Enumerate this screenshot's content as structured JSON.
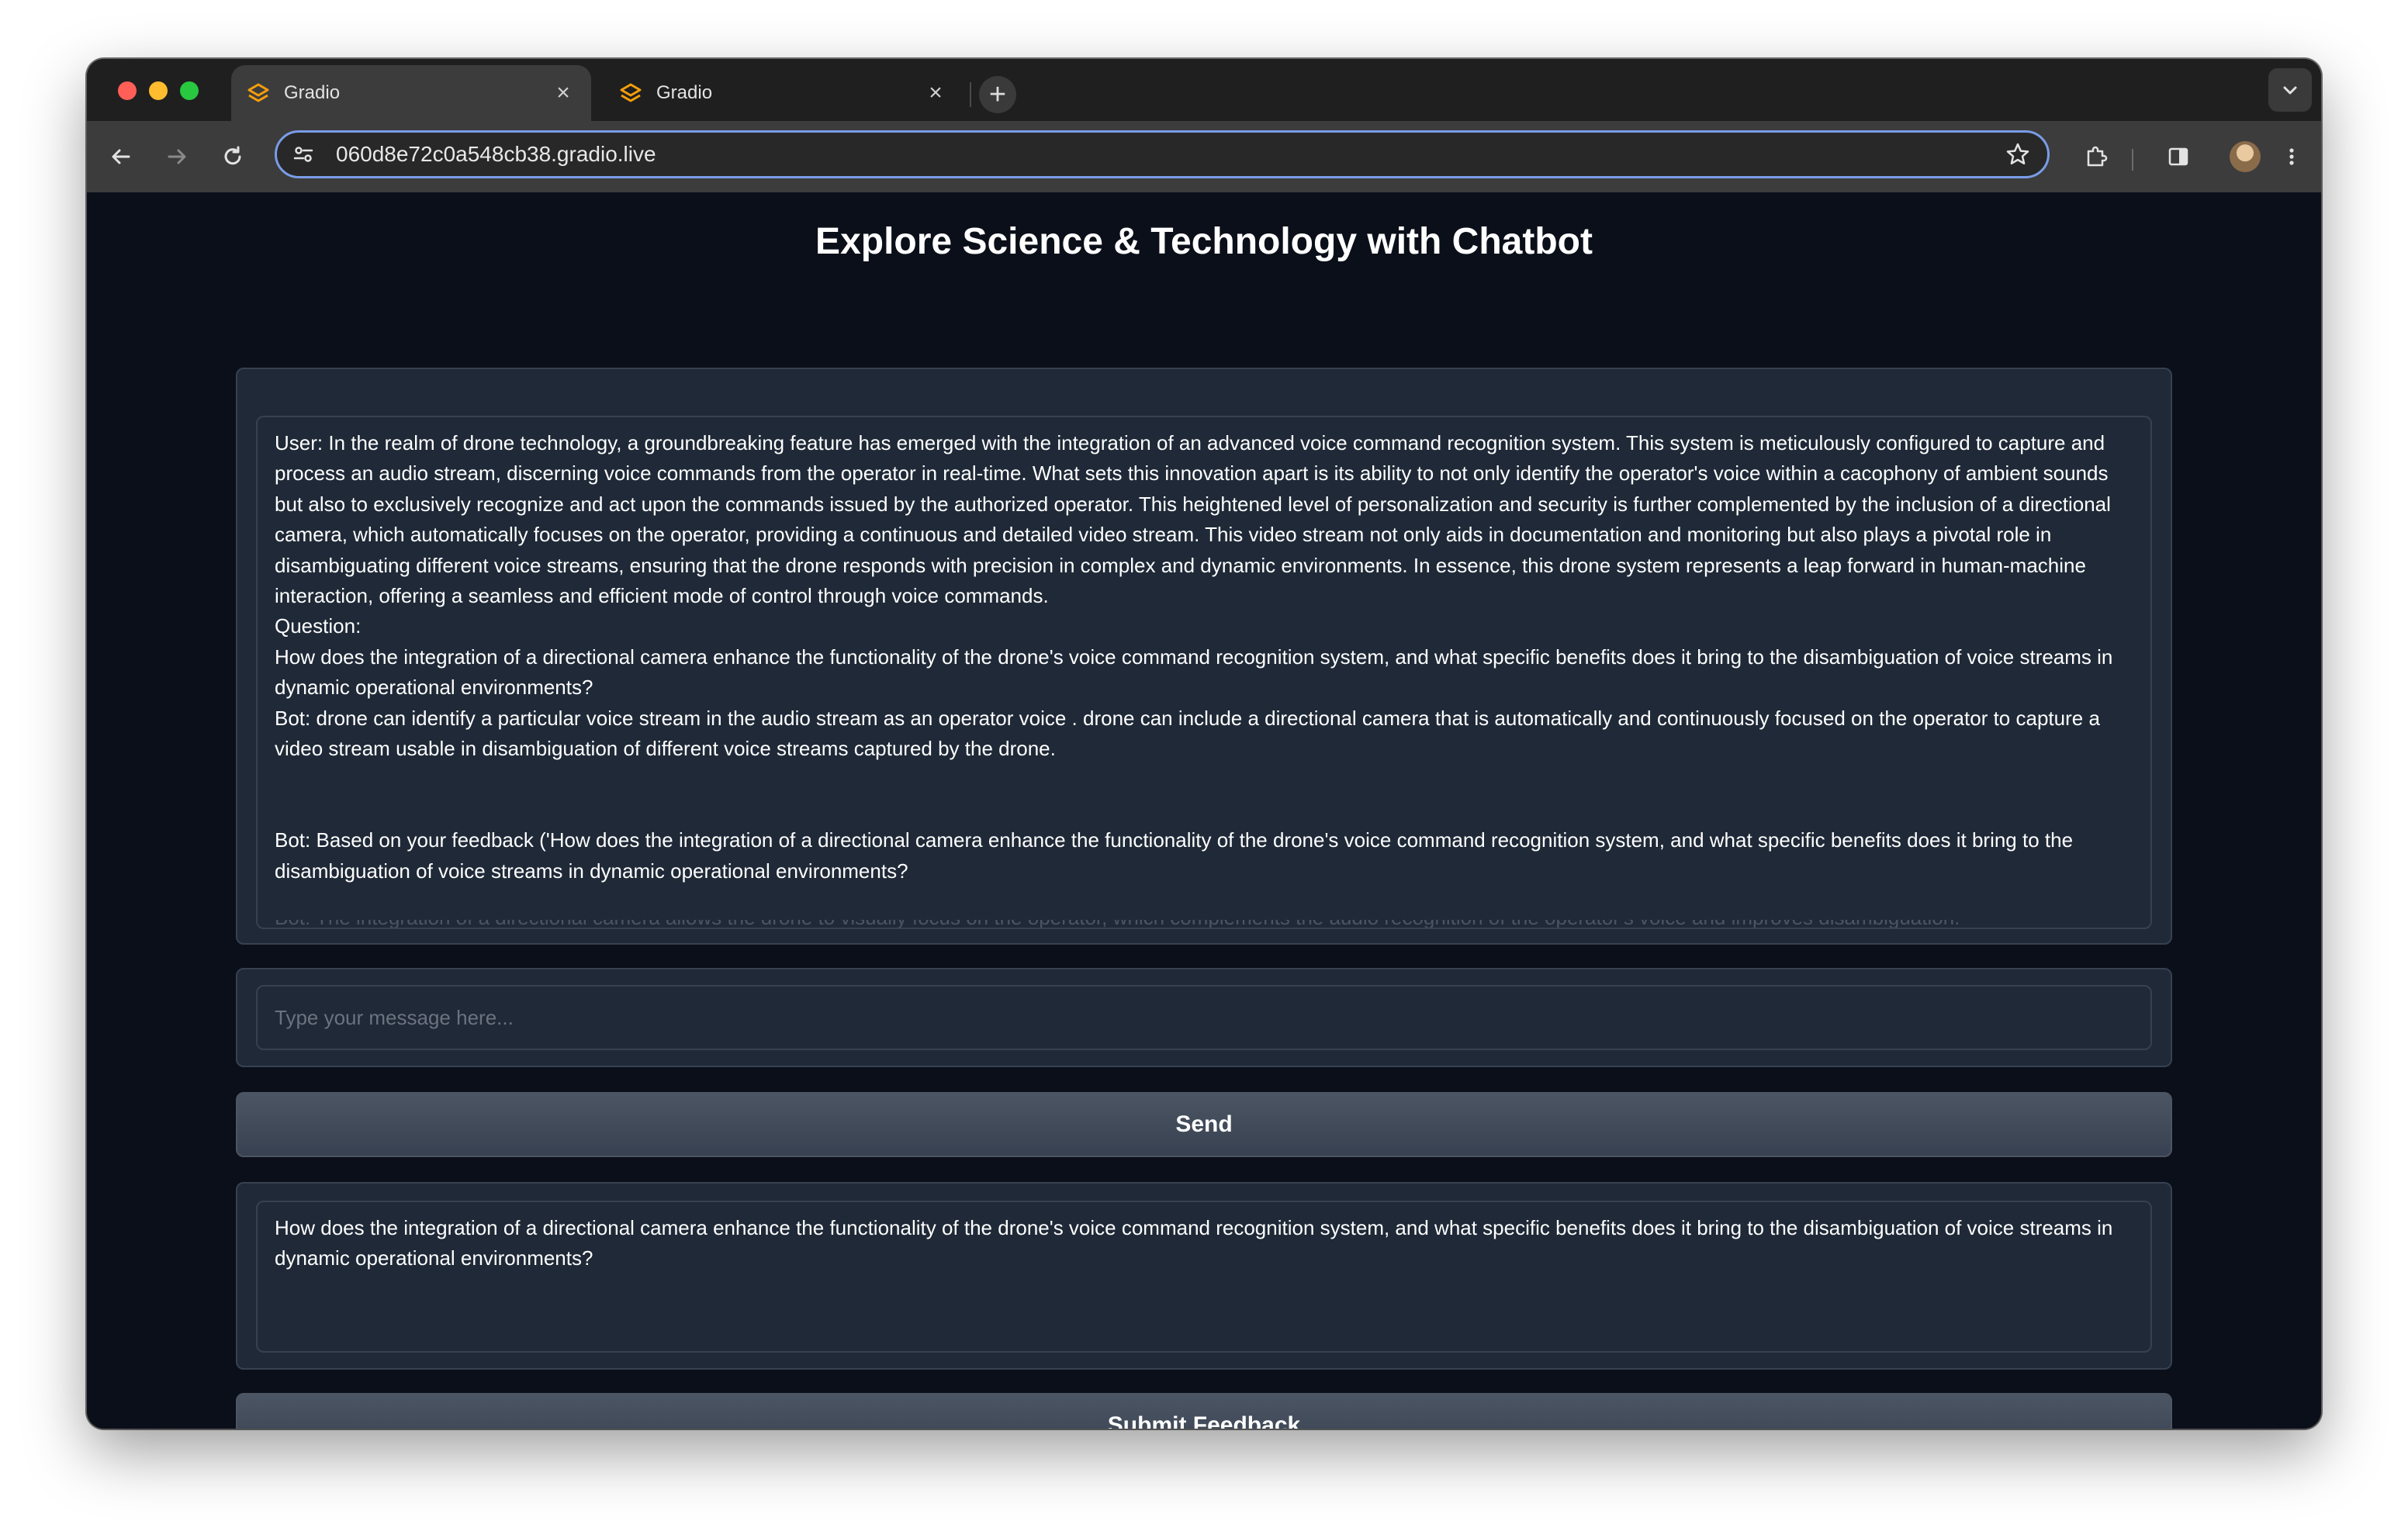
{
  "browser": {
    "tabs": [
      {
        "title": "Gradio",
        "favicon": "gradio-icon",
        "active": true
      },
      {
        "title": "Gradio",
        "favicon": "gradio-icon",
        "active": false
      }
    ],
    "url": "060d8e72c0a548cb38.gradio.live",
    "accent_color": "#7a9ce8"
  },
  "app": {
    "heading": "Explore Science & Technology with Chatbot",
    "chat_log": "User: In the realm of drone technology, a groundbreaking feature has emerged with the integration of an advanced voice command recognition system. This system is meticulously configured to capture and process an audio stream, discerning voice commands from the operator in real-time. What sets this innovation apart is its ability to not only identify the operator's voice within a cacophony of ambient sounds but also to exclusively recognize and act upon the commands issued by the authorized operator. This heightened level of personalization and security is further complemented by the inclusion of a directional camera, which automatically focuses on the operator, providing a continuous and detailed video stream. This video stream not only aids in documentation and monitoring but also plays a pivotal role in disambiguating different voice streams, ensuring that the drone responds with precision in complex and dynamic environments. In essence, this drone system represents a leap forward in human-machine interaction, offering a seamless and efficient mode of control through voice commands.\nQuestion:\nHow does the integration of a directional camera enhance the functionality of the drone's voice command recognition system, and what specific benefits does it bring to the disambiguation of voice streams in dynamic operational environments?\nBot: drone can identify a particular voice stream in the audio stream as an operator voice . drone can include a directional camera that is automatically and continuously focused on the operator to capture a video stream usable in disambiguation of different voice streams captured by the drone.\n\n\nBot: Based on your feedback ('How does the integration of a directional camera enhance the functionality of the drone's voice command recognition system, and what specific benefits does it bring to the disambiguation of voice streams in dynamic operational environments?",
    "chat_log_cutoff": "Bot: The integration of a directional camera allows the drone to visually focus on the operator, which complements the audio recognition of the operator's voice and improves disambiguation.",
    "message_placeholder": "Type your message here...",
    "send_label": "Send",
    "feedback_value": "How does the integration of a directional camera enhance the functionality of the drone's voice command recognition system, and what specific benefits does it bring to the disambiguation of voice streams in dynamic operational environments?",
    "submit_feedback_label": "Submit Feedback"
  }
}
